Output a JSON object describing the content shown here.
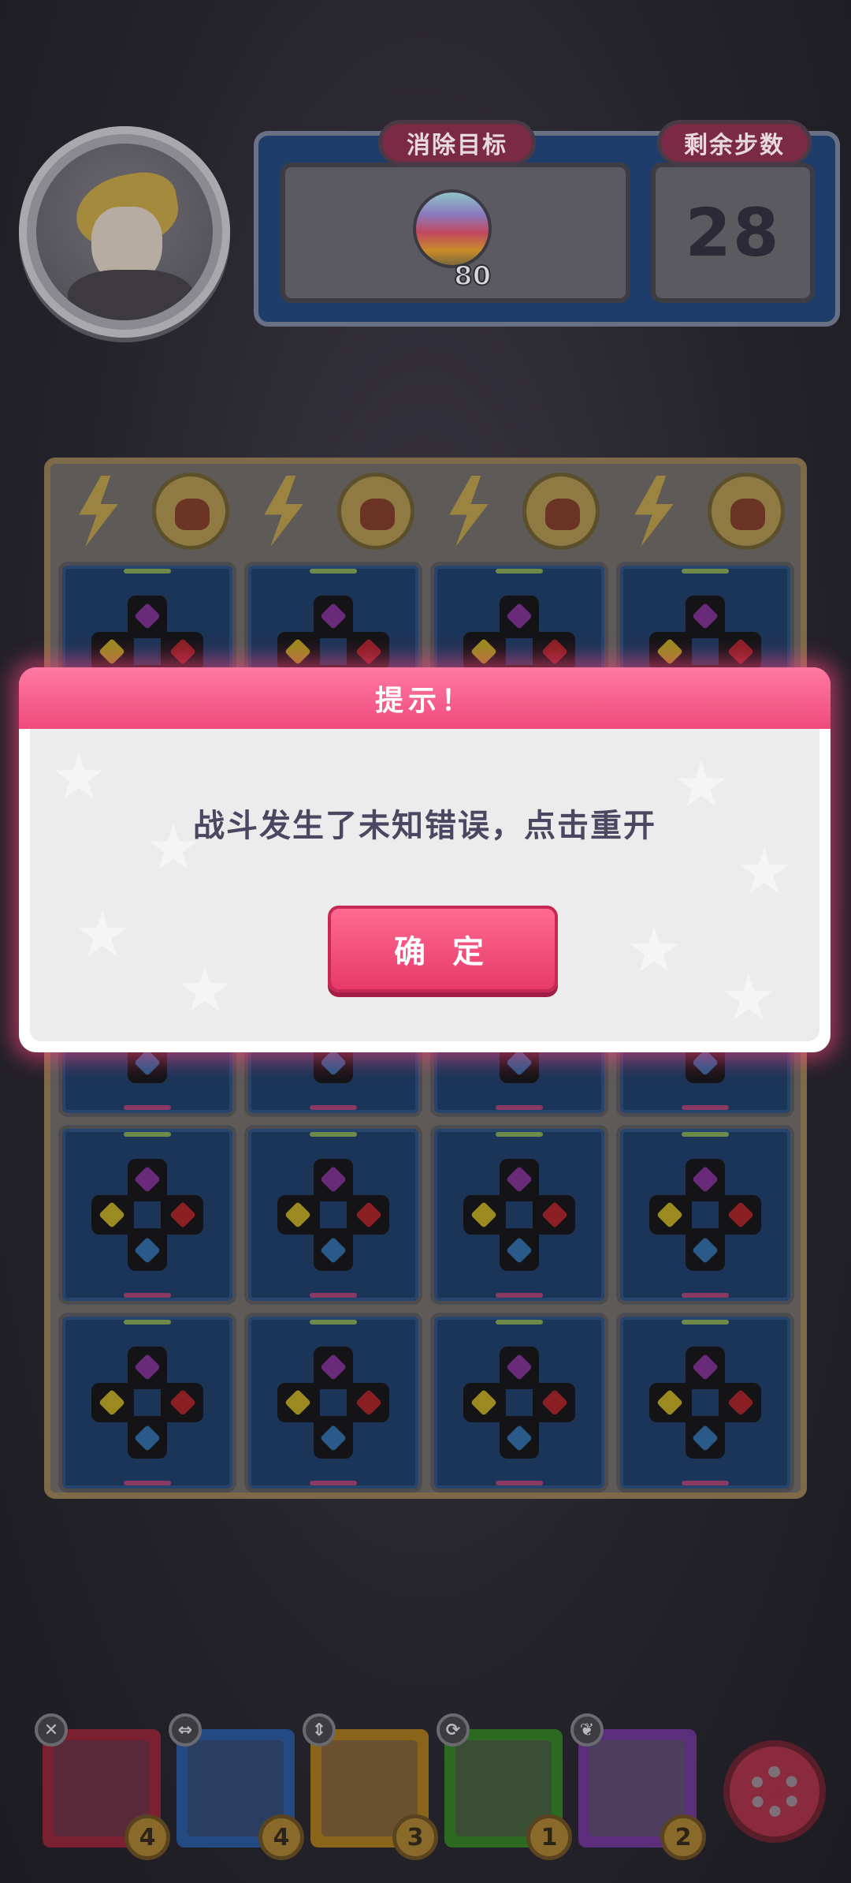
{
  "hud": {
    "goal_label": "消除目标",
    "goal_count": "80",
    "goal_icon": "rainbow-orb-icon",
    "steps_label": "剩余步数",
    "steps_value": "28"
  },
  "board": {
    "columns": 4,
    "rows": 5,
    "top_row_icons": [
      "lightning-icon",
      "helmet-icon"
    ]
  },
  "heroes": [
    {
      "badge_icon": "cross-icon",
      "badge": "✕",
      "count": "4",
      "border": "#7a2030",
      "bg": "#5a2a3a"
    },
    {
      "badge_icon": "swap-horizontal-icon",
      "badge": "⇔",
      "count": "4",
      "border": "#234a82",
      "bg": "#2a3e62"
    },
    {
      "badge_icon": "swap-vertical-icon",
      "badge": "⇕",
      "count": "3",
      "border": "#8a6418",
      "bg": "#6a5230"
    },
    {
      "badge_icon": "refresh-icon",
      "badge": "⟳",
      "count": "1",
      "border": "#2c6a22",
      "bg": "#3a4e34"
    },
    {
      "badge_icon": "swirl-icon",
      "badge": "❦",
      "count": "2",
      "border": "#5a2e7a",
      "bg": "#4e3e5e"
    }
  ],
  "modal": {
    "title": "提示！",
    "message": "战斗发生了未知错误，点击重开",
    "ok_label": "确 定"
  },
  "colors": {
    "modal_accent": "#ef4a7c",
    "hud_blue": "#1f3d6b"
  }
}
